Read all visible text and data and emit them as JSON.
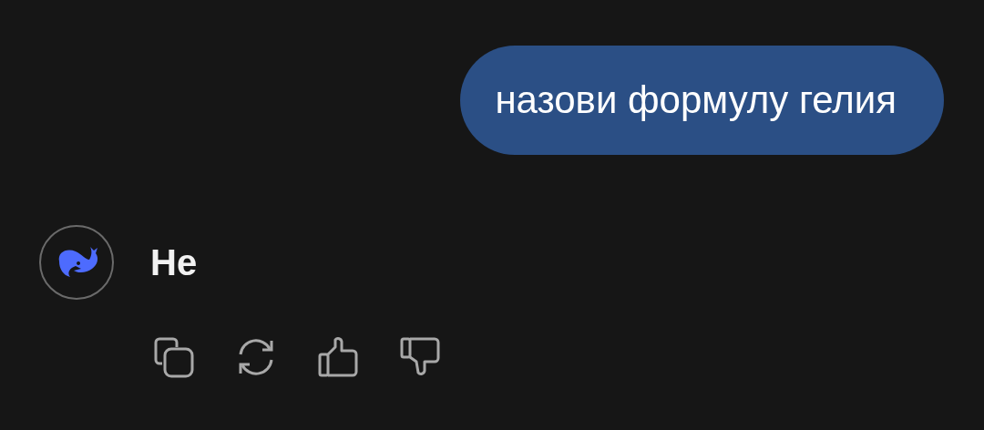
{
  "user_message": {
    "text": "назови формулу гелия"
  },
  "reply": {
    "text": "He"
  }
}
